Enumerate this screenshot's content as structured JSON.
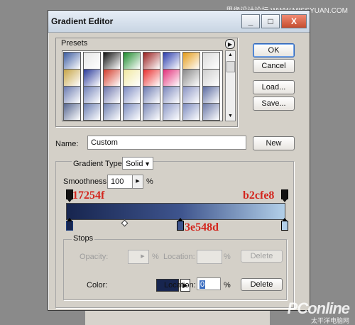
{
  "watermark": {
    "top": "思缘设计论坛 WWW.MISSYUAN.COM",
    "brand": "PConline",
    "sub": "太平洋电脑网"
  },
  "window": {
    "title": "Gradient Editor",
    "buttons": {
      "minimize": "_",
      "maximize": "□",
      "close": "X"
    }
  },
  "presets": {
    "label": "Presets",
    "menu_icon": "right-triangle-icon",
    "swatches": [
      [
        "#3b5ba0",
        "#e6e6e6",
        "#111111",
        "#1a8a2a",
        "#9b1d1d",
        "#2a3cae",
        "#e49b17",
        "#dadada"
      ],
      [
        "#c6a447",
        "#2a3a9a",
        "#d23b2a",
        "#f0e8a0",
        "#e92e2e",
        "#e2307a",
        "#8a8a8a",
        "#cfcfcf"
      ],
      [
        "#6a7ab0",
        "#7080b8",
        "#6a72aa",
        "#7a88c0",
        "#6a78b0",
        "#7a86bc",
        "#8a94c4",
        "#5a6aa0"
      ],
      [
        "#55658f",
        "#6a7db2",
        "#6e7fb0",
        "#7b8cc0",
        "#7a88b8",
        "#8d9ac8",
        "#7d8cc0",
        "#6a78a8"
      ]
    ]
  },
  "buttons": {
    "ok": "OK",
    "cancel": "Cancel",
    "load": "Load...",
    "save": "Save...",
    "new": "New"
  },
  "name": {
    "label": "Name:",
    "value": "Custom"
  },
  "gradient": {
    "type_label": "Gradient Type:",
    "type_value": "Solid",
    "smoothness_label": "Smoothness:",
    "smoothness_value": "100",
    "percent": "%",
    "start_color": "#17254f",
    "mid_color": "#3e548d",
    "end_color": "#b2cfe8",
    "annotations": {
      "left": "17254f",
      "right": "b2cfe8",
      "mid": "3e548d"
    }
  },
  "stops": {
    "label": "Stops",
    "opacity_label": "Opacity:",
    "opacity_value": "",
    "location_label": "Location:",
    "location_value_opacity": "",
    "location_value_color": "0",
    "color_label": "Color:",
    "delete_label": "Delete",
    "percent": "%"
  }
}
